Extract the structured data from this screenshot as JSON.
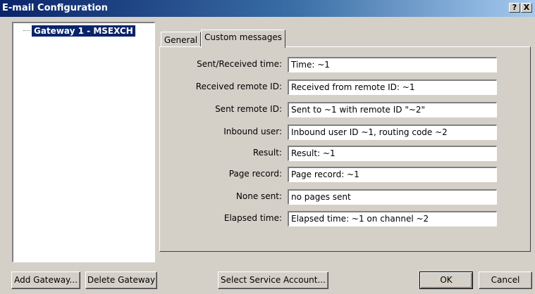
{
  "window": {
    "title": "E-mail Configuration",
    "help_label": "?",
    "close_label": "X"
  },
  "tree": {
    "items": [
      {
        "label": "Gateway 1 - MSEXCH",
        "selected": true
      }
    ]
  },
  "tabs": [
    {
      "label": "General",
      "active": false
    },
    {
      "label": "Custom messages",
      "active": true
    }
  ],
  "fields": [
    {
      "label": "Sent/Received time:",
      "value": "Time: ~1"
    },
    {
      "label": "Received remote ID:",
      "value": "Received from remote ID: ~1"
    },
    {
      "label": "Sent remote ID:",
      "value": "Sent to ~1 with remote ID \"~2\""
    },
    {
      "label": "Inbound user:",
      "value": "Inbound user ID ~1, routing code ~2"
    },
    {
      "label": "Result:",
      "value": "Result: ~1"
    },
    {
      "label": "Page record:",
      "value": "Page record: ~1"
    },
    {
      "label": "None sent:",
      "value": "no pages sent"
    },
    {
      "label": "Elapsed time:",
      "value": "Elapsed time: ~1 on channel ~2"
    }
  ],
  "buttons": {
    "add_gateway": "Add Gateway...",
    "delete_gateway": "Delete Gateway",
    "select_service_account": "Select Service Account...",
    "ok": "OK",
    "cancel": "Cancel"
  },
  "colors": {
    "title_gradient_start": "#0a246a",
    "title_gradient_end": "#a6caf0",
    "selection": "#0a246a",
    "dialog_face": "#d4d0c8"
  }
}
